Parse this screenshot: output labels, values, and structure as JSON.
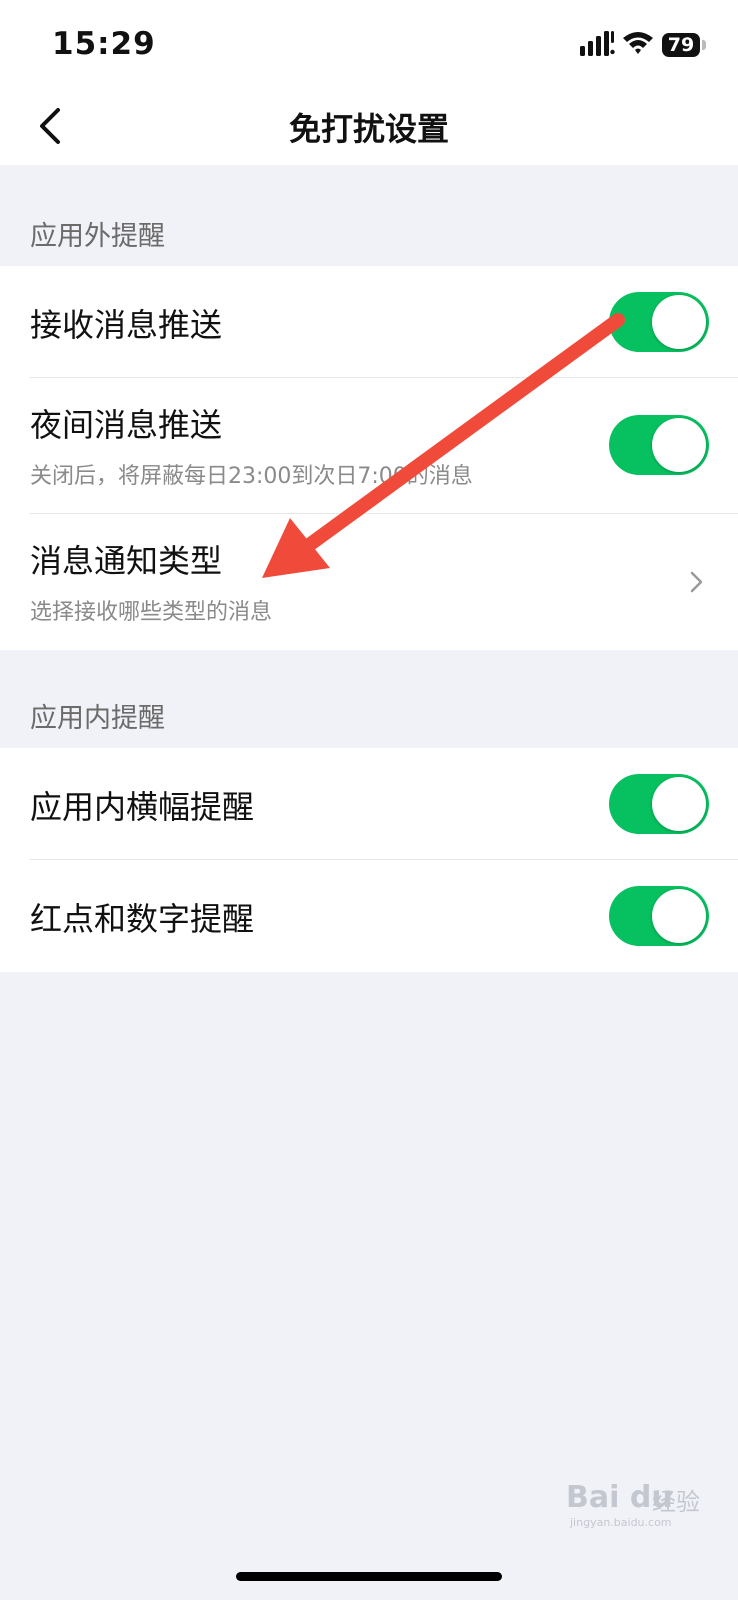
{
  "status_bar": {
    "time": "15:29",
    "battery": "79"
  },
  "header": {
    "title": "免打扰设置"
  },
  "sections": [
    {
      "header": "应用外提醒"
    },
    {
      "header": "应用内提醒"
    }
  ],
  "rows": {
    "receive_push": {
      "title": "接收消息推送",
      "on": true
    },
    "night_push": {
      "title": "夜间消息推送",
      "subtitle": "关闭后，将屏蔽每日23:00到次日7:00的消息",
      "on": true
    },
    "notify_types": {
      "title": "消息通知类型",
      "subtitle": "选择接收哪些类型的消息"
    },
    "banner": {
      "title": "应用内横幅提醒",
      "on": true
    },
    "badge": {
      "title": "红点和数字提醒",
      "on": true
    }
  },
  "watermark": {
    "brand": "Bai du",
    "cn": "经验",
    "url": "jingyan.baidu.com"
  },
  "colors": {
    "toggle_on": "#07c160",
    "annotation_arrow": "#f04a3a",
    "background": "#f1f2f7"
  },
  "icons": {
    "back": "chevron-left-icon",
    "row_more": "chevron-right-icon"
  }
}
